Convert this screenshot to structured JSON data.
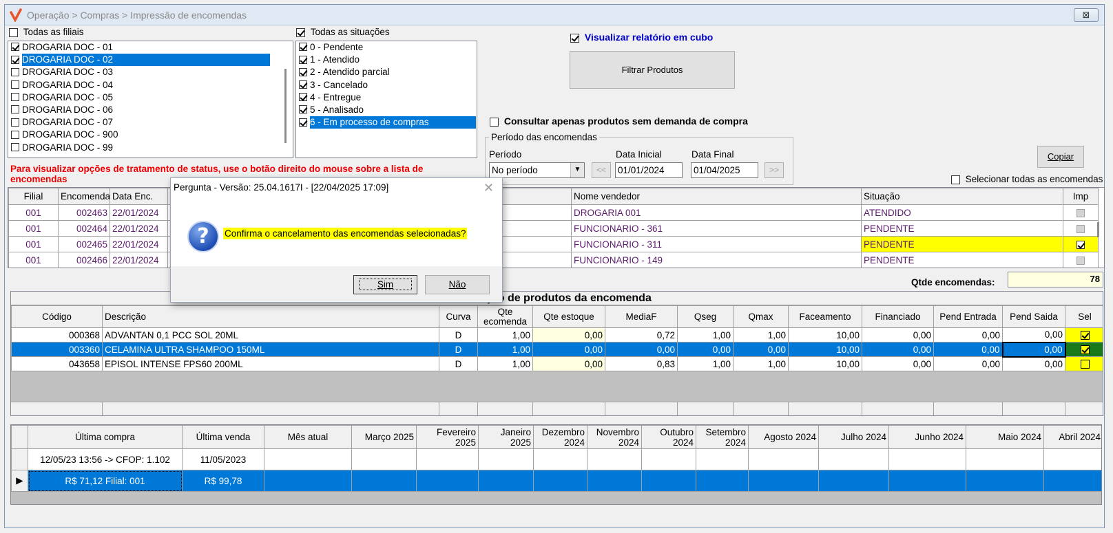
{
  "window": {
    "title": "Operação > Compras > Impressão de encomendas",
    "close_label": "⊠"
  },
  "filiais": {
    "all_label": "Todas as filiais",
    "all_checked": false,
    "items": [
      {
        "label": "DROGARIA DOC - 01",
        "checked": true,
        "selected": false
      },
      {
        "label": "DROGARIA DOC - 02",
        "checked": true,
        "selected": true
      },
      {
        "label": "DROGARIA DOC - 03",
        "checked": false,
        "selected": false
      },
      {
        "label": "DROGARIA DOC - 04",
        "checked": false,
        "selected": false
      },
      {
        "label": "DROGARIA DOC - 05",
        "checked": false,
        "selected": false
      },
      {
        "label": "DROGARIA DOC - 06",
        "checked": false,
        "selected": false
      },
      {
        "label": "DROGARIA DOC - 07",
        "checked": false,
        "selected": false
      },
      {
        "label": "DROGARIA DOC - 900",
        "checked": false,
        "selected": false
      },
      {
        "label": "DROGARIA DOC - 99",
        "checked": false,
        "selected": false
      }
    ]
  },
  "situacoes": {
    "all_label": "Todas as situações",
    "all_checked": true,
    "items": [
      {
        "label": "0 - Pendente",
        "checked": true,
        "selected": false
      },
      {
        "label": "1 - Atendido",
        "checked": true,
        "selected": false
      },
      {
        "label": "2 - Atendido parcial",
        "checked": true,
        "selected": false
      },
      {
        "label": "3 - Cancelado",
        "checked": true,
        "selected": false
      },
      {
        "label": "4 - Entregue",
        "checked": true,
        "selected": false
      },
      {
        "label": "5 - Analisado",
        "checked": true,
        "selected": false
      },
      {
        "label": "6 - Em processo de compras",
        "checked": true,
        "selected": true
      }
    ]
  },
  "options": {
    "cubo_label": "Visualizar relatório em cubo",
    "cubo_checked": true,
    "filtrar_label": "Filtrar Produtos",
    "sem_demanda_label": "Consultar apenas produtos sem demanda de compra",
    "sem_demanda_checked": false
  },
  "periodo": {
    "group_title": "Período das encomendas",
    "periodo_label": "Período",
    "periodo_value": "No período",
    "data_inicial_label": "Data Inicial",
    "data_inicial": "01/01/2024",
    "data_final_label": "Data Final",
    "data_final": "01/04/2025",
    "prev_label": "<<",
    "next_label": ">>"
  },
  "copiar_label": "Copiar",
  "selecionar_todas_label": "Selecionar todas as encomendas",
  "status_hint": "Para visualizar opções de tratamento de status, use o botão direito do mouse sobre a lista de encomendas",
  "encomendas": {
    "headers": {
      "filial": "Filial",
      "encomenda": "Encomenda",
      "data": "Data Enc.",
      "vendedor": "Nome vendedor",
      "situacao": "Situação",
      "imp": "Imp"
    },
    "rows": [
      {
        "filial": "001",
        "encomenda": "002463",
        "data": "22/01/2024",
        "vendedor": "DROGARIA 001",
        "situacao": "ATENDIDO",
        "imp": false
      },
      {
        "filial": "001",
        "encomenda": "002464",
        "data": "22/01/2024",
        "vendedor": "FUNCIONARIO - 361",
        "situacao": "PENDENTE",
        "imp": false
      },
      {
        "filial": "001",
        "encomenda": "002465",
        "data": "22/01/2024",
        "vendedor": "FUNCIONARIO - 311",
        "situacao": "PENDENTE",
        "imp": true
      },
      {
        "filial": "001",
        "encomenda": "002466",
        "data": "22/01/2024",
        "vendedor": "FUNCIONARIO - 149",
        "situacao": "PENDENTE",
        "imp": false
      }
    ]
  },
  "qtde_encomendas_label": "Qtde encomendas:",
  "qtde_encomendas_value": "78",
  "produtos": {
    "title": "Relação de produtos da encomenda",
    "headers": {
      "codigo": "Código",
      "descricao": "Descrição",
      "curva": "Curva",
      "qte_encomenda": "Qte ecomenda",
      "qte_estoque": "Qte estoque",
      "mediaf": "MediaF",
      "qseg": "Qseg",
      "qmax": "Qmax",
      "faceamento": "Faceamento",
      "financiado": "Financiado",
      "pend_entrada": "Pend Entrada",
      "pend_saida": "Pend Saida",
      "sel": "Sel"
    },
    "rows": [
      {
        "codigo": "000368",
        "descricao": "ADVANTAN 0,1 PCC SOL 20ML",
        "curva": "D",
        "qte_encomenda": "1,00",
        "qte_estoque": "0,00",
        "mediaf": "0,72",
        "qseg": "1,00",
        "qmax": "1,00",
        "faceamento": "10,00",
        "financiado": "0,00",
        "pend_entrada": "0,00",
        "pend_saida": "0,00",
        "sel": true
      },
      {
        "codigo": "003360",
        "descricao": "CELAMINA ULTRA SHAMPOO 150ML",
        "curva": "D",
        "qte_encomenda": "1,00",
        "qte_estoque": "0,00",
        "mediaf": "0,00",
        "qseg": "0,00",
        "qmax": "0,00",
        "faceamento": "10,00",
        "financiado": "0,00",
        "pend_entrada": "0,00",
        "pend_saida": "0,00",
        "sel": true
      },
      {
        "codigo": "043658",
        "descricao": "EPISOL INTENSE FPS60 200ML",
        "curva": "D",
        "qte_encomenda": "1,00",
        "qte_estoque": "0,00",
        "mediaf": "0,83",
        "qseg": "1,00",
        "qmax": "1,00",
        "faceamento": "10,00",
        "financiado": "0,00",
        "pend_entrada": "0,00",
        "pend_saida": "0,00",
        "sel": false
      }
    ]
  },
  "historico": {
    "headers": [
      "Última compra",
      "Última venda",
      "Mês atual",
      "Março 2025",
      "Fevereiro 2025",
      "Janeiro 2025",
      "Dezembro 2024",
      "Novembro 2024",
      "Outubro 2024",
      "Setembro 2024",
      "Agosto 2024",
      "Julho 2024",
      "Junho 2024",
      "Maio 2024",
      "Abril 2024"
    ],
    "row1": {
      "ultima_compra": "12/05/23 13:56 -> CFOP: 1.102",
      "ultima_venda": "11/05/2023"
    },
    "row2": {
      "ultima_compra": "R$ 71,12 Filial: 001",
      "ultima_venda": "R$ 99,78"
    }
  },
  "dialog": {
    "title": "Pergunta - Versão: 25.04.1617I - [22/04/2025 17:09]",
    "message": "Confirma o cancelamento das encomendas selecionadas?",
    "yes_label": "Sim",
    "no_label": "Não",
    "icon": "question-icon"
  }
}
